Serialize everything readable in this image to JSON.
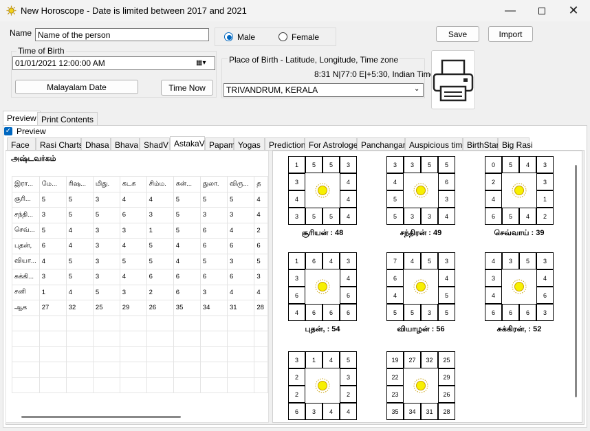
{
  "window": {
    "title": "New Horoscope - Date is limited between 2017 and 2021"
  },
  "form": {
    "name_label": "Name",
    "name_value": "Name of the person",
    "gender": {
      "male": "Male",
      "female": "Female",
      "selected": "Male"
    },
    "save": "Save",
    "import": "Import",
    "time_of_birth_label": "Time of Birth",
    "datetime_value": "01/01/2021  12:00:00 AM",
    "malayalam_date": "Malayalam Date",
    "time_now": "Time Now",
    "place_label": "Place of Birth - Latitude, Longitude, Time zone",
    "coords": "8:31 N|77:0 E|+5:30, Indian Time",
    "place_value": "TRIVANDRUM, KERALA"
  },
  "outer_tabs": [
    "Preview",
    "Print Contents"
  ],
  "preview_checkbox": "Preview",
  "inner_tabs": [
    "Face",
    "Rasi Charts",
    "Dhasa",
    "Bhava",
    "ShadV",
    "AstakaV",
    "Papam",
    "Yogas",
    "Prediction",
    "For Astrologer",
    "Panchangam",
    "Auspicious time",
    "BirthStar",
    "Big Rasi"
  ],
  "selected_inner_tab": "AstakaV",
  "astaka": {
    "heading": "அஷ்டவர்கம்",
    "header": [
      "இரா...",
      "மே...",
      "ரிஷ...",
      "மிது.",
      "கடக",
      "சிம்ம.",
      "கன்...",
      "துலா.",
      "விரு...",
      "த"
    ],
    "rows": [
      [
        "சூரி...",
        "5",
        "5",
        "3",
        "4",
        "4",
        "5",
        "5",
        "5",
        "4"
      ],
      [
        "சந்தி...",
        "3",
        "5",
        "5",
        "6",
        "3",
        "5",
        "3",
        "3",
        "4"
      ],
      [
        "செவ்...",
        "5",
        "4",
        "3",
        "3",
        "1",
        "5",
        "6",
        "4",
        "2"
      ],
      [
        "புதன்,",
        "6",
        "4",
        "3",
        "4",
        "5",
        "4",
        "6",
        "6",
        "6"
      ],
      [
        "வியா...",
        "4",
        "5",
        "3",
        "5",
        "5",
        "4",
        "5",
        "3",
        "5"
      ],
      [
        "சுக்கி...",
        "3",
        "5",
        "3",
        "4",
        "6",
        "6",
        "6",
        "6",
        "3"
      ],
      [
        "சனி",
        "1",
        "4",
        "5",
        "3",
        "2",
        "6",
        "3",
        "4",
        "4"
      ],
      [
        "ஆக",
        "27",
        "32",
        "25",
        "29",
        "26",
        "35",
        "34",
        "31",
        "28"
      ]
    ]
  },
  "charts": [
    {
      "title": "சூரியன் : 48",
      "top": [
        "1",
        "5",
        "5",
        "3"
      ],
      "right": [
        "4",
        "4"
      ],
      "bottom": [
        "3",
        "5",
        "5",
        "4"
      ],
      "left": [
        "3",
        "4"
      ]
    },
    {
      "title": "சந்திரன் : 49",
      "top": [
        "3",
        "3",
        "5",
        "5"
      ],
      "right": [
        "6",
        "3"
      ],
      "bottom": [
        "5",
        "3",
        "3",
        "4"
      ],
      "left": [
        "4",
        "5"
      ]
    },
    {
      "title": "செவ்வாய் : 39",
      "top": [
        "0",
        "5",
        "4",
        "3"
      ],
      "right": [
        "3",
        "1"
      ],
      "bottom": [
        "6",
        "5",
        "4",
        "2"
      ],
      "left": [
        "2",
        "4"
      ]
    },
    {
      "title": "புதன், : 54",
      "top": [
        "1",
        "6",
        "4",
        "3"
      ],
      "right": [
        "4",
        "6"
      ],
      "bottom": [
        "4",
        "6",
        "6",
        "6"
      ],
      "left": [
        "3",
        "6"
      ]
    },
    {
      "title": "வியாழன் : 56",
      "top": [
        "7",
        "4",
        "5",
        "3"
      ],
      "right": [
        "4",
        "5"
      ],
      "bottom": [
        "5",
        "5",
        "3",
        "5"
      ],
      "left": [
        "6",
        "4"
      ]
    },
    {
      "title": "சுக்கிரன், : 52",
      "top": [
        "4",
        "3",
        "5",
        "3"
      ],
      "right": [
        "4",
        "6"
      ],
      "bottom": [
        "6",
        "6",
        "6",
        "3"
      ],
      "left": [
        "3",
        "4"
      ]
    },
    {
      "title": "",
      "top": [
        "3",
        "1",
        "4",
        "5"
      ],
      "right": [
        "3",
        "2"
      ],
      "bottom": [
        "6",
        "3",
        "4",
        "4"
      ],
      "left": [
        "2",
        "2"
      ]
    },
    {
      "title": "",
      "top": [
        "19",
        "27",
        "32",
        "25"
      ],
      "right": [
        "29",
        "26"
      ],
      "bottom": [
        "35",
        "34",
        "31",
        "28"
      ],
      "left": [
        "22",
        "23"
      ]
    }
  ]
}
